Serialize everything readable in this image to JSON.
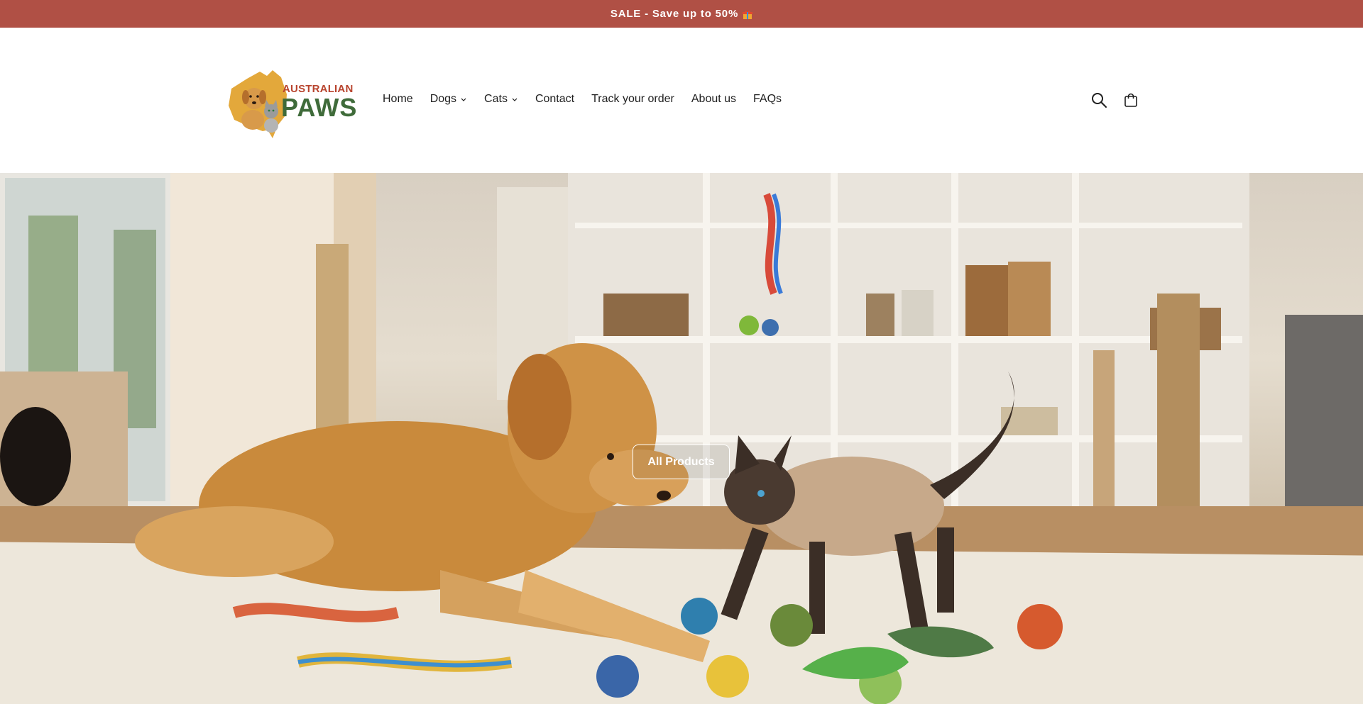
{
  "announcement": {
    "text": "SALE - Save up to 50%",
    "gift_icon": "gift-icon"
  },
  "logo": {
    "line1": "AUSTRALIAN",
    "line2": "PAWS"
  },
  "nav": {
    "home": "Home",
    "dogs": "Dogs",
    "cats": "Cats",
    "contact": "Contact",
    "track": "Track your order",
    "about": "About us",
    "faqs": "FAQs"
  },
  "header_icons": [
    "search-icon",
    "cart-icon"
  ],
  "hero": {
    "button_label": "All Products"
  },
  "colors": {
    "announcement_bg": "#b05045",
    "logo_red": "#b8442e",
    "logo_green": "#3f6b3a",
    "logo_gold": "#e3a83b"
  }
}
